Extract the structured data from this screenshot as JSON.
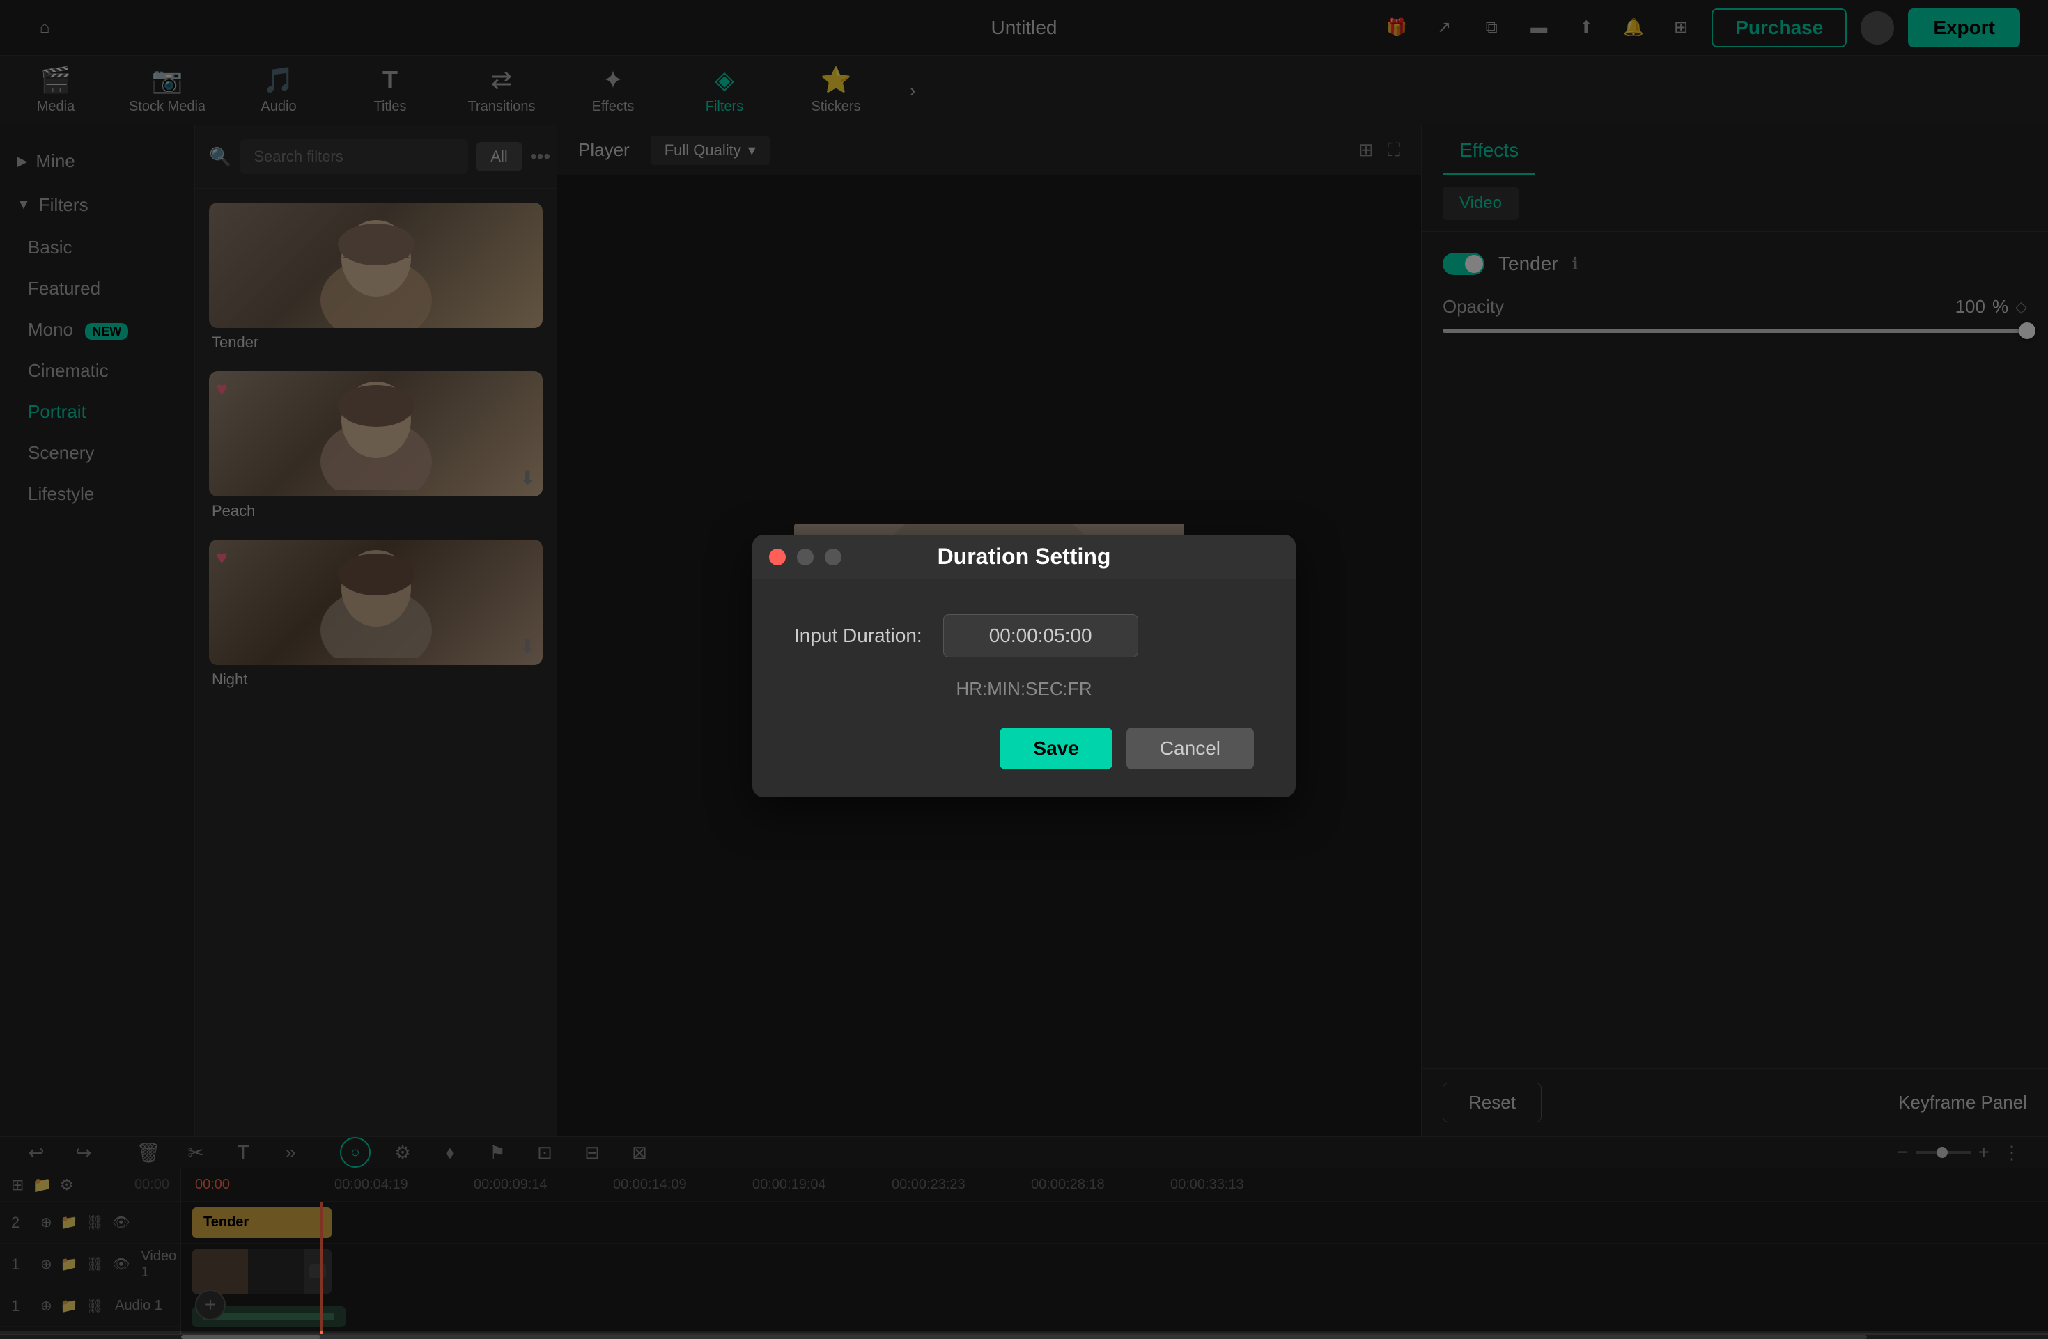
{
  "app": {
    "title": "Untitled",
    "purchase_label": "Purchase",
    "export_label": "Export"
  },
  "toolbar": {
    "items": [
      {
        "id": "media",
        "label": "Media",
        "icon": "🎬"
      },
      {
        "id": "stock",
        "label": "Stock Media",
        "icon": "📷"
      },
      {
        "id": "audio",
        "label": "Audio",
        "icon": "🎵"
      },
      {
        "id": "titles",
        "label": "Titles",
        "icon": "T"
      },
      {
        "id": "transitions",
        "label": "Transitions",
        "icon": "↔"
      },
      {
        "id": "effects",
        "label": "Effects",
        "icon": "✨"
      },
      {
        "id": "filters",
        "label": "Filters",
        "icon": "🎨"
      },
      {
        "id": "stickers",
        "label": "Stickers",
        "icon": "⭐"
      }
    ]
  },
  "left_panel": {
    "mine_label": "Mine",
    "filters_label": "Filters",
    "nav_items": [
      {
        "id": "basic",
        "label": "Basic",
        "active": false
      },
      {
        "id": "featured",
        "label": "Featured",
        "active": false
      },
      {
        "id": "mono",
        "label": "Mono",
        "badge": "NEW",
        "active": false
      },
      {
        "id": "cinematic",
        "label": "Cinematic",
        "active": false
      },
      {
        "id": "portrait",
        "label": "Portrait",
        "active": true
      },
      {
        "id": "scenery",
        "label": "Scenery",
        "active": false
      },
      {
        "id": "lifestyle",
        "label": "Lifestyle",
        "active": false
      }
    ]
  },
  "filter_panel": {
    "search_placeholder": "Search filters",
    "tag_label": "All",
    "filters": [
      {
        "name": "Tender",
        "has_heart": false,
        "has_download": false
      },
      {
        "name": "Peach",
        "has_heart": true,
        "has_download": true
      },
      {
        "name": "Night",
        "has_heart": true,
        "has_download": true
      }
    ]
  },
  "player": {
    "tab_label": "Player",
    "quality_label": "Full Quality"
  },
  "right_panel": {
    "tab_effects": "Effects",
    "tab_video": "Video",
    "effect_name": "Tender",
    "opacity_label": "Opacity",
    "opacity_value": "100",
    "opacity_unit": "%",
    "reset_label": "Reset",
    "keyframe_label": "Keyframe Panel"
  },
  "dialog": {
    "title": "Duration Setting",
    "input_label": "Input Duration:",
    "input_value": "00:00:05:00",
    "hint": "HR:MIN:SEC:FR",
    "save_label": "Save",
    "cancel_label": "Cancel"
  },
  "timeline": {
    "times": [
      "00:00",
      "00:00:04:19",
      "00:00:09:14",
      "00:00:14:09",
      "00:00:19:04",
      "00:00:23:23",
      "00:00:28:18",
      "00:00:33:13"
    ],
    "tracks": [
      {
        "num": "2",
        "label": ""
      },
      {
        "num": "1",
        "label": "Video 1"
      },
      {
        "num": "1",
        "label": "Audio 1"
      }
    ],
    "filter_clip_label": "Tender",
    "video_clip_label": "",
    "audio_clip_label": ""
  }
}
